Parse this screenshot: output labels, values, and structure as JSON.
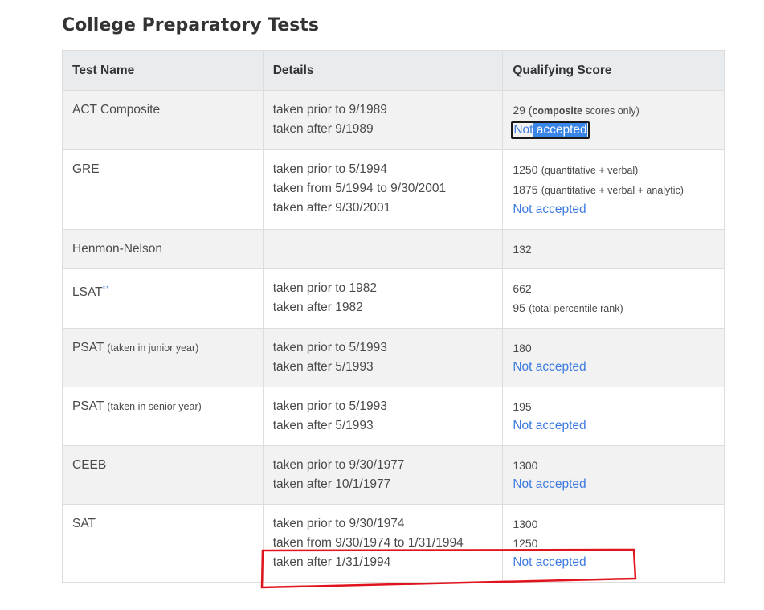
{
  "heading": "College Preparatory Tests",
  "columns": {
    "name": "Test Name",
    "details": "Details",
    "score": "Qualifying Score"
  },
  "rows": [
    {
      "name": "ACT Composite",
      "details": [
        "taken prior to 9/1989",
        "taken after 9/1989"
      ],
      "score_line1_prefix": "29 (",
      "score_line1_bold": "composite",
      "score_line1_suffix": " scores only)",
      "score_not_accepted_part1": "Not",
      "score_not_accepted_part2": " accepted"
    },
    {
      "name": "GRE",
      "details": [
        "taken prior to 5/1994",
        "taken from 5/1994 to 9/30/2001",
        "taken after 9/30/2001"
      ],
      "score_line1_value": "1250",
      "score_line1_note": "(quantitative + verbal)",
      "score_line2_value": "1875",
      "score_line2_note": "(quantitative + verbal + analytic)",
      "score_not_accepted": "Not accepted"
    },
    {
      "name": "Henmon-Nelson",
      "details": [],
      "score_line1_value": "132"
    },
    {
      "name": "LSAT",
      "name_marker": "**",
      "details": [
        "taken prior to 1982",
        "taken after 1982"
      ],
      "score_line1_value": "662",
      "score_line2_value": "95",
      "score_line2_note": "(total percentile rank)"
    },
    {
      "name": "PSAT",
      "name_note": "(taken in junior year)",
      "details": [
        "taken prior to 5/1993",
        "taken after 5/1993"
      ],
      "score_line1_value": "180",
      "score_not_accepted": "Not accepted"
    },
    {
      "name": "PSAT",
      "name_note": "(taken in senior year)",
      "details": [
        "taken prior to 5/1993",
        "taken after 5/1993"
      ],
      "score_line1_value": "195",
      "score_not_accepted": "Not accepted"
    },
    {
      "name": "CEEB",
      "details": [
        "taken prior to 9/30/1977",
        "taken after 10/1/1977"
      ],
      "score_line1_value": "1300",
      "score_not_accepted": "Not accepted"
    },
    {
      "name": "SAT",
      "details": [
        "taken prior to 9/30/1974",
        "taken from 9/30/1974 to 1/31/1994",
        "taken after 1/31/1994"
      ],
      "score_line1_value": "1300",
      "score_line2_value": "1250",
      "score_not_accepted": "Not accepted"
    }
  ],
  "annotation_color": "#e0141e"
}
